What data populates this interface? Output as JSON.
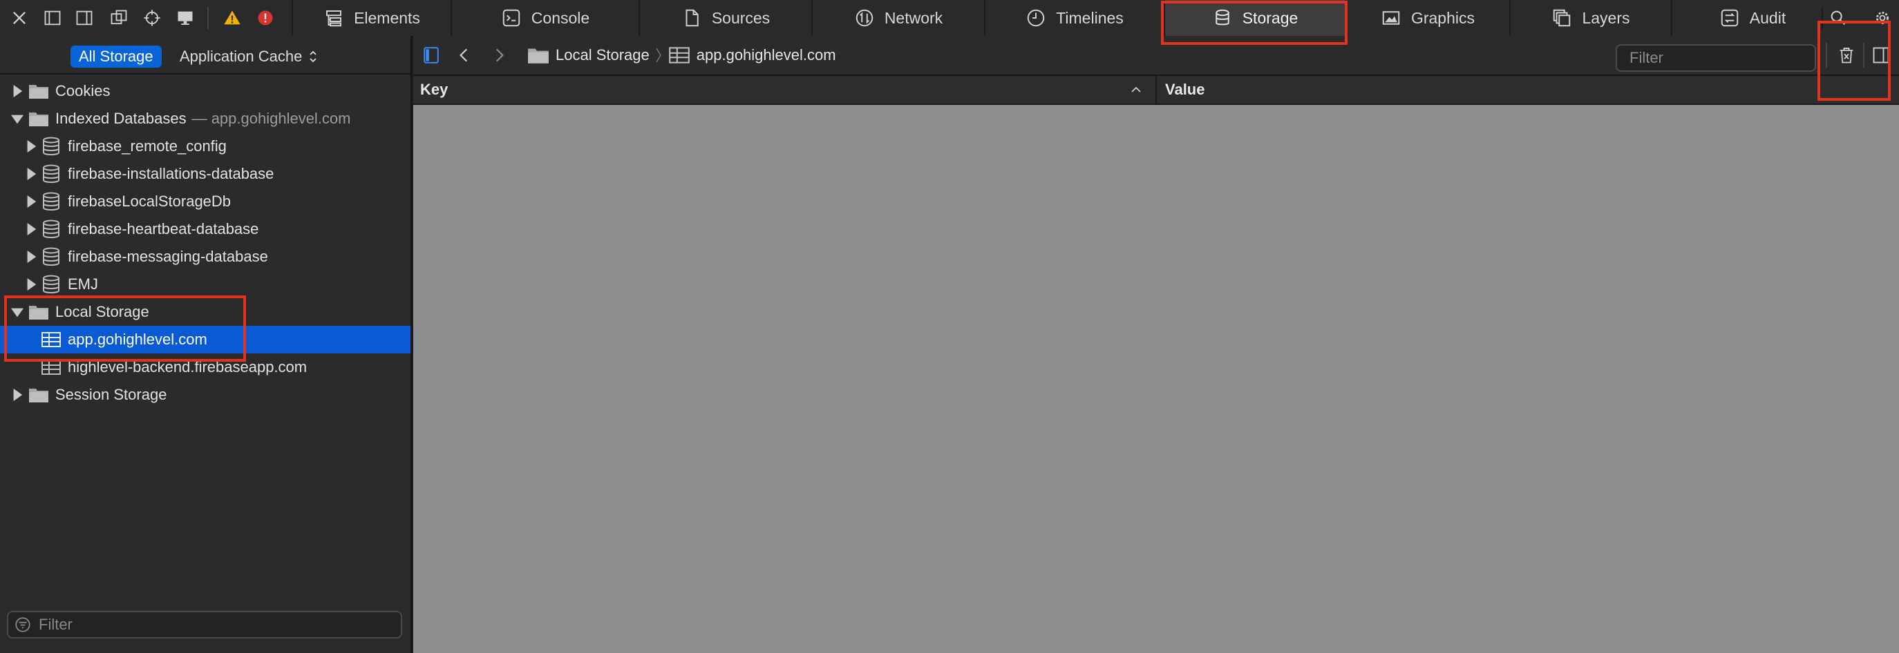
{
  "tabs": [
    {
      "label": "Elements",
      "icon": "elements-icon"
    },
    {
      "label": "Console",
      "icon": "console-icon"
    },
    {
      "label": "Sources",
      "icon": "sources-icon"
    },
    {
      "label": "Network",
      "icon": "network-icon"
    },
    {
      "label": "Timelines",
      "icon": "timelines-icon"
    },
    {
      "label": "Storage",
      "icon": "storage-icon",
      "active": true
    },
    {
      "label": "Graphics",
      "icon": "graphics-icon"
    },
    {
      "label": "Layers",
      "icon": "layers-icon"
    },
    {
      "label": "Audit",
      "icon": "audit-icon"
    }
  ],
  "scope": {
    "all_storage": "All Storage",
    "app_cache": "Application Cache"
  },
  "tree": {
    "cookies": "Cookies",
    "indexed_db": {
      "label": "Indexed Databases",
      "sub": "— app.gohighlevel.com"
    },
    "databases": [
      "firebase_remote_config",
      "firebase-installations-database",
      "firebaseLocalStorageDb",
      "firebase-heartbeat-database",
      "firebase-messaging-database",
      "EMJ"
    ],
    "local_storage": "Local Storage",
    "local_items": [
      "app.gohighlevel.com",
      "highlevel-backend.firebaseapp.com"
    ],
    "session_storage": "Session Storage"
  },
  "sidebar_filter": {
    "placeholder": "Filter"
  },
  "breadcrumb": {
    "folder": "Local Storage",
    "item": "app.gohighlevel.com"
  },
  "main_filter": {
    "placeholder": "Filter"
  },
  "columns": {
    "key": "Key",
    "value": "Value"
  },
  "colors": {
    "accent": "#0a64d9",
    "highlight": "#e03321",
    "warning": "#f0b400",
    "error": "#d8322c"
  }
}
